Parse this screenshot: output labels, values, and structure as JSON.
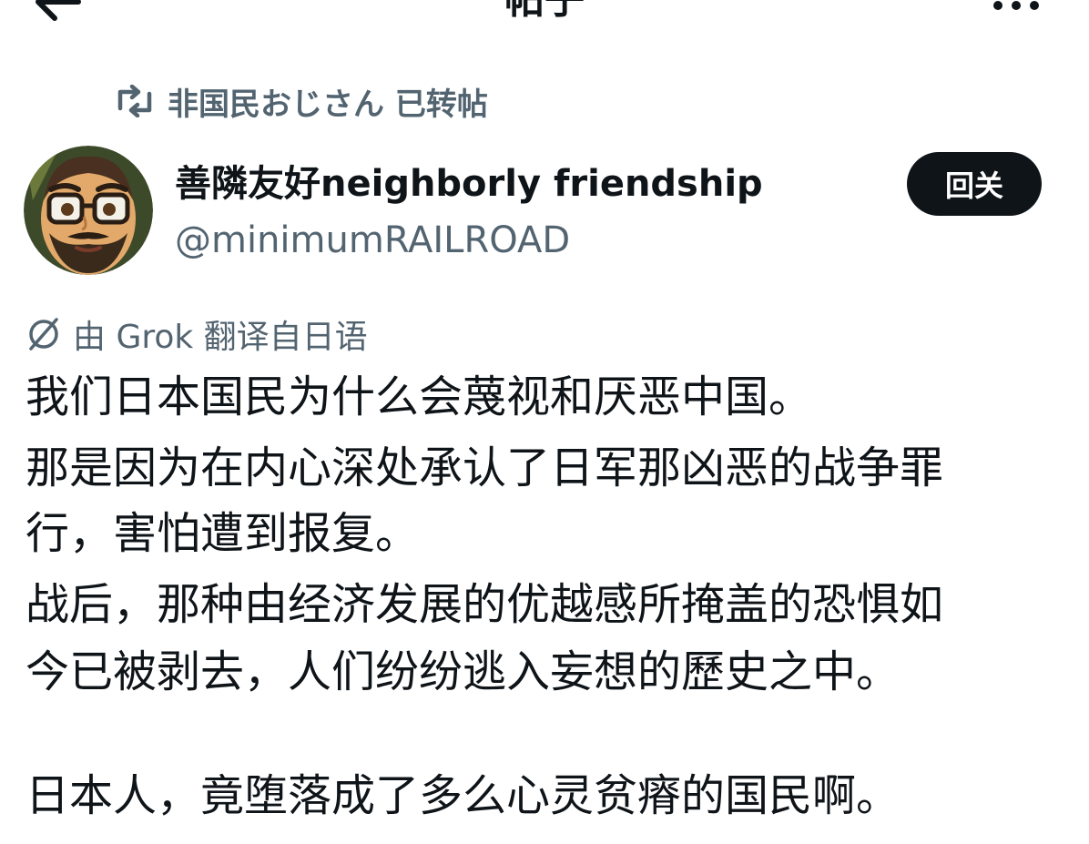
{
  "header": {
    "title": "帖子",
    "back_icon": "back-arrow-icon",
    "more_icon": "more-dots-icon"
  },
  "repost": {
    "icon": "repost-icon",
    "text": "非国民おじさん 已转帖"
  },
  "author": {
    "display_name": "善隣友好neighborly friendship",
    "handle": "@minimumRAILROAD",
    "avatar_icon": "avatar-cartoon-man"
  },
  "follow_button": {
    "label": "回关"
  },
  "translation": {
    "icon": "translate-icon",
    "text": "由 Grok 翻译自日语"
  },
  "post": {
    "lines": [
      "我们日本国民为什么会蔑视和厌恶中国。",
      "那是因为在内心深处承认了日军那凶恶的战争罪",
      "行，害怕遭到报复。",
      "战后，那种由经济发展的优越感所掩盖的恐惧如",
      "今已被剥去，人们纷纷逃入妄想的歷史之中。",
      "日本人，竟堕落成了多么心灵贫瘠的国民啊。"
    ]
  },
  "colors": {
    "text": "#0f1419",
    "secondary": "#536471",
    "button_bg": "#0f1419"
  }
}
